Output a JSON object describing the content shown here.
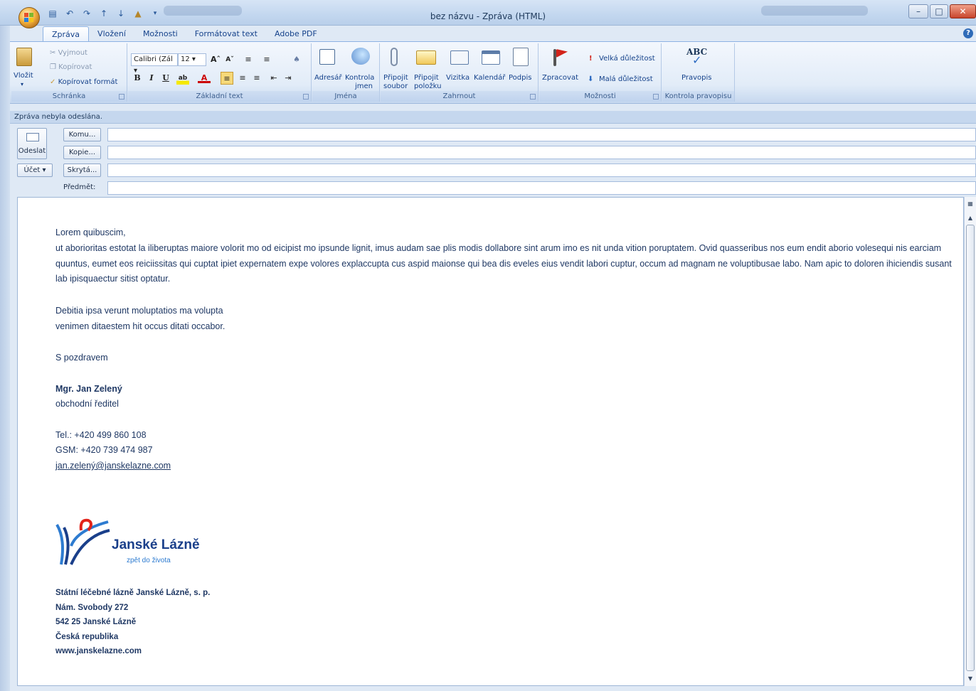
{
  "window": {
    "title": "bez názvu - Zpráva (HTML)"
  },
  "ribbon": {
    "tabs": [
      {
        "label": "Zpráva",
        "active": true
      },
      {
        "label": "Vložení"
      },
      {
        "label": "Možnosti"
      },
      {
        "label": "Formátovat text"
      },
      {
        "label": "Adobe PDF"
      }
    ],
    "clipboard": {
      "group_label": "Schránka",
      "paste": "Vložit",
      "cut": "Vyjmout",
      "copy": "Kopírovat",
      "format_painter": "Kopírovat formát"
    },
    "basic_text": {
      "group_label": "Základní text",
      "font_name": "Calibri (Zál",
      "font_size": "12"
    },
    "names": {
      "group_label": "Jména",
      "address_book": "Adresář",
      "check_names_1": "Kontrola",
      "check_names_2": "jmen"
    },
    "include": {
      "group_label": "Zahrnout",
      "attach_file_1": "Připojit",
      "attach_file_2": "soubor",
      "attach_item_1": "Připojit",
      "attach_item_2": "položku",
      "business_card": "Vizitka",
      "calendar": "Kalendář",
      "signature": "Podpis"
    },
    "options": {
      "group_label": "Možnosti",
      "follow_up": "Zpracovat",
      "high_importance": "Velká důležitost",
      "low_importance": "Malá důležitost"
    },
    "proofing": {
      "group_label": "Kontrola pravopisu",
      "spelling": "Pravopis",
      "abc": "ABC"
    }
  },
  "infobar": "Zpráva nebyla odeslána.",
  "address": {
    "send": "Odeslat",
    "account": "Účet",
    "to": "Komu...",
    "cc": "Kopie...",
    "bcc": "Skrytá...",
    "subject_label": "Předmět:",
    "to_value": "",
    "cc_value": "",
    "bcc_value": "",
    "subject_value": ""
  },
  "body": {
    "greeting": "Lorem quibuscim,",
    "paragraph": "ut aborioritas estotat la iliberuptas maiore volorit mo od eicipist mo ipsunde lignit, imus audam sae plis modis dollabore sint arum imo es nit unda vition poruptatem. Ovid quasseribus nos eum endit aborio volesequi nis earciam quuntus, eumet eos reiciissitas qui cuptat ipiet expernatem expe volores explaccupta cus aspid maionse qui bea dis eveles eius vendit labori cuptur, occum ad magnam ne voluptibusae labo. Nam apic to doloren ihiciendis susant lab ipisquaectur sitist optatur.",
    "line1": "Debitia ipsa verunt moluptatios ma volupta",
    "line2": "venimen ditaestem hit occus ditati occabor.",
    "closing": "S pozdravem",
    "name": "Mgr. Jan Zelený",
    "position": "obchodní ředitel",
    "tel": "Tel.:    +420 499 860 108",
    "gsm": "GSM:  +420 739 474 987",
    "email": "jan.zelený@janskelazne.com"
  },
  "logo": {
    "name": "Janské Lázně",
    "tagline": "zpět do života",
    "colors": {
      "dark_blue": "#1a3f8a",
      "light_blue": "#2d7bd0",
      "red": "#e2231a"
    }
  },
  "footer": {
    "company": "Státní léčebné lázně Janské Lázně, s. p.",
    "street": "Nám. Svobody 272",
    "city": "542 25 Janské Lázně",
    "country": "Česká republika",
    "web": "www.janskelazne.com"
  }
}
